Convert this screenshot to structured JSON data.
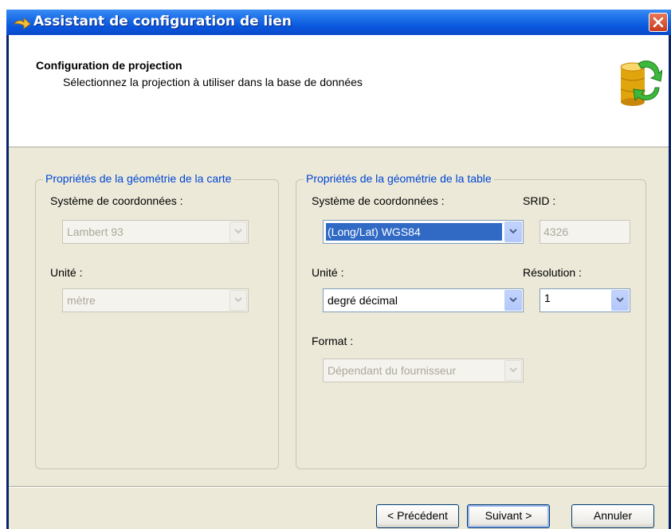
{
  "window": {
    "title": "Assistant de configuration de lien"
  },
  "header": {
    "title": "Configuration de projection",
    "subtitle": "Sélectionnez la projection à utiliser dans la base de données"
  },
  "map_group": {
    "legend": "Propriétés de la géométrie de la carte",
    "coord_label": "Système de coordonnées :",
    "coord_value": "Lambert 93",
    "unit_label": "Unité :",
    "unit_value": "mètre"
  },
  "table_group": {
    "legend": "Propriétés de la géométrie de la table",
    "coord_label": "Système de coordonnées :",
    "coord_value": "(Long/Lat) WGS84",
    "srid_label": "SRID :",
    "srid_value": "4326",
    "unit_label": "Unité :",
    "unit_value": "degré décimal",
    "resolution_label": "Résolution :",
    "resolution_value": "1",
    "format_label": "Format :",
    "format_value": "Dépendant du fournisseur"
  },
  "buttons": {
    "previous": "< Précédent",
    "next": "Suivant >",
    "cancel": "Annuler"
  },
  "icons": {
    "close": "close-icon",
    "title": "wizard-arrow-icon",
    "header": "database-sync-icon",
    "dropdown": "chevron-down-icon"
  },
  "colors": {
    "titlebar": "#0a55dc",
    "legend": "#0046d5",
    "selection": "#316ac5",
    "dialog": "#ece9d8"
  }
}
